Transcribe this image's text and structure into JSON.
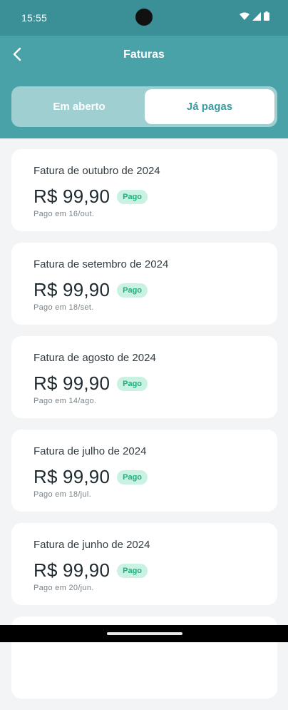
{
  "status_bar": {
    "time": "15:55"
  },
  "header": {
    "title": "Faturas"
  },
  "tabs": {
    "open_label": "Em aberto",
    "paid_label": "Já pagas"
  },
  "colors": {
    "accent": "#4aa2a9",
    "status_bar": "#3b8f97",
    "badge_bg": "#c9f2e3",
    "badge_text": "#1fb07c"
  },
  "invoices": [
    {
      "title": "Fatura de outubro de 2024",
      "amount": "R$ 99,90",
      "status": "Pago",
      "paid_on": "Pago em 16/out."
    },
    {
      "title": "Fatura de setembro de 2024",
      "amount": "R$ 99,90",
      "status": "Pago",
      "paid_on": "Pago em 18/set."
    },
    {
      "title": "Fatura de agosto de 2024",
      "amount": "R$ 99,90",
      "status": "Pago",
      "paid_on": "Pago em 14/ago."
    },
    {
      "title": "Fatura de julho de 2024",
      "amount": "R$ 99,90",
      "status": "Pago",
      "paid_on": "Pago em 18/jul."
    },
    {
      "title": "Fatura de junho de 2024",
      "amount": "R$ 99,90",
      "status": "Pago",
      "paid_on": "Pago em 20/jun."
    }
  ]
}
